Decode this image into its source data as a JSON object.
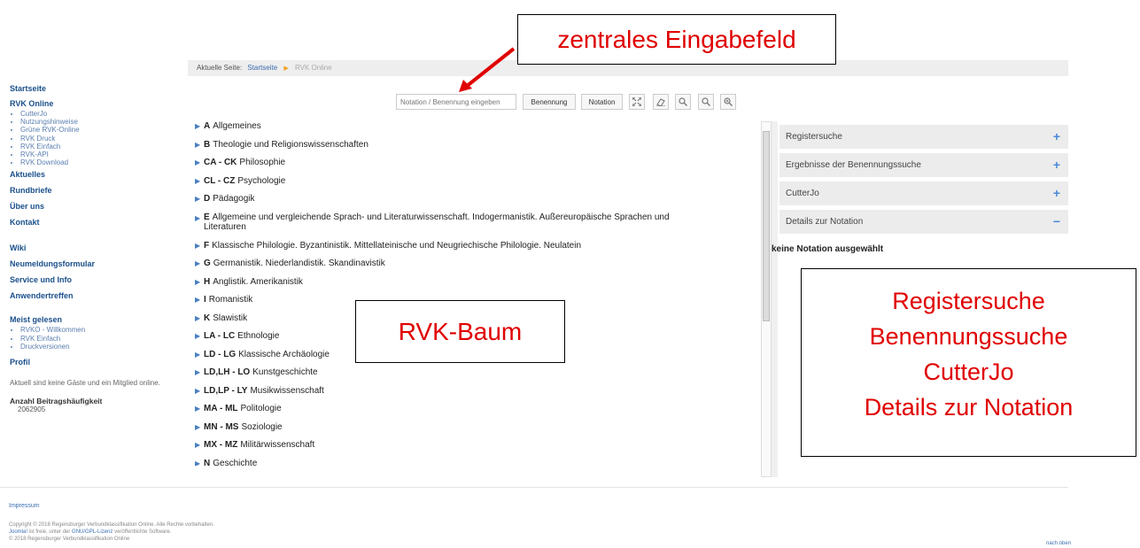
{
  "sidebar": {
    "startseite": "Startseite",
    "rvk_online": "RVK Online",
    "rvk_sub": [
      "CutterJo",
      "Nutzungshinweise",
      "Grüne RVK-Online",
      "RVK Druck",
      "RVK Einfach",
      "RVK-API",
      "RVK Download"
    ],
    "aktuelles": "Aktuelles",
    "rundbriefe": "Rundbriefe",
    "ueber_uns": "Über uns",
    "kontakt": "Kontakt",
    "wiki": "Wiki",
    "neumeldung": "Neumeldungsformular",
    "service": "Service und Info",
    "anwender": "Anwendertreffen",
    "meist_gelesen": "Meist gelesen",
    "meist_sub": [
      "RVKO - Willkommen",
      "RVK Einfach",
      "Druckversionen"
    ],
    "profil": "Profil",
    "online_text": "Aktuell sind keine Gäste und ein Mitglied online.",
    "beitrag_label": "Anzahl Beitragshäufigkeit",
    "beitrag_count": "2062905"
  },
  "breadcrumb": {
    "prefix": "Aktuelle Seite:",
    "home": "Startseite",
    "current": "RVK Online"
  },
  "toolbar": {
    "search_placeholder": "Notation / Benennung eingeben",
    "benennung": "Benennung",
    "notation": "Notation",
    "icons": [
      "expand-icon",
      "eraser-icon",
      "zoom-out-icon",
      "zoom-icon",
      "zoom-in-icon"
    ]
  },
  "tree": [
    {
      "code": "A",
      "label": "Allgemeines"
    },
    {
      "code": "B",
      "label": "Theologie und Religionswissenschaften"
    },
    {
      "code": "CA - CK",
      "label": "Philosophie"
    },
    {
      "code": "CL - CZ",
      "label": "Psychologie"
    },
    {
      "code": "D",
      "label": "Pädagogik"
    },
    {
      "code": "E",
      "label": "Allgemeine und vergleichende Sprach- und Literaturwissenschaft. Indogermanistik. Außereuropäische Sprachen und Literaturen"
    },
    {
      "code": "F",
      "label": "Klassische Philologie. Byzantinistik. Mittellateinische und Neugriechische Philologie. Neulatein"
    },
    {
      "code": "G",
      "label": "Germanistik. Niederlandistik. Skandinavistik"
    },
    {
      "code": "H",
      "label": "Anglistik. Amerikanistik"
    },
    {
      "code": "I",
      "label": "Romanistik"
    },
    {
      "code": "K",
      "label": "Slawistik"
    },
    {
      "code": "LA - LC",
      "label": "Ethnologie"
    },
    {
      "code": "LD - LG",
      "label": "Klassische Archäologie"
    },
    {
      "code": "LD,LH - LO",
      "label": "Kunstgeschichte"
    },
    {
      "code": "LD,LP - LY",
      "label": "Musikwissenschaft"
    },
    {
      "code": "MA - ML",
      "label": "Politologie"
    },
    {
      "code": "MN - MS",
      "label": "Soziologie"
    },
    {
      "code": "MX - MZ",
      "label": "Militärwissenschaft"
    },
    {
      "code": "N",
      "label": "Geschichte"
    }
  ],
  "accordion": [
    {
      "label": "Registersuche",
      "state": "+"
    },
    {
      "label": "Ergebnisse der Benennungssuche",
      "state": "+"
    },
    {
      "label": "CutterJo",
      "state": "+"
    },
    {
      "label": "Details zur Notation",
      "state": "−"
    }
  ],
  "details_text": "keine Notation ausgewählt",
  "annotations": {
    "eingabefeld": "zentrales Eingabefeld",
    "baum": "RVK-Baum",
    "right_lines": [
      "Registersuche",
      "Benennungssuche",
      "CutterJo",
      "Details zur Notation"
    ],
    "color": "#e00000"
  },
  "footer": {
    "impressum": "Impressum",
    "copyright1": "Copyright © 2018 Regensburger Verbundklassifikation Online. Alle Rechte vorbehalten.",
    "joomla": "Joomla!",
    "copyright2_mid": " ist freie, unter der ",
    "gnu": "GNU/GPL-Lizenz",
    "copyright2_end": " veröffentlichte Software.",
    "copyright3": "© 2018 Regensburger Verbundklassifikation Online",
    "back_top": "nach oben"
  }
}
